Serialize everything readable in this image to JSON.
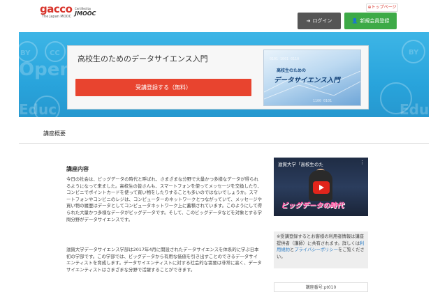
{
  "header": {
    "logo_text": "gacco",
    "logo_sub": "The Japan MOOC",
    "coop_small": "Certified by",
    "coop_big": "JMOOC",
    "toppage_label": "トップページ",
    "login_label": "ログイン",
    "register_label": "新規会員登録"
  },
  "hero": {
    "course_title": "高校生のためのデータサイエンス入門",
    "enroll_label": "受講登録する（無料）",
    "thumb_small": "高校生のための",
    "thumb_big": "データサイエンス入門"
  },
  "section": {
    "title": "講座概要"
  },
  "content": {
    "heading": "講座内容",
    "para1": "今日の社会は、ビッグデータの時代と呼ばれ、さまざまな分野で大量かつ多様なデータが得られるようになって来ました。高校生の皆さんも、スマートフォンを使ってメッセージを交換したり、コンビニでポイントカードを使って買い物をしたりすることも多いのではないでしょうか。スマートフォンやコンビニのレジは、コンピューターのネットワークとつながっていて、メッセージや買い物の履歴はデータとしてコンピュータネットワーク上に蓄積されています。このようにして得られた大量かつ多様なデータがビッグデータです。そして、このビッグデータなどを対象とする学問分野がデータサイエンスです。",
    "para2": "滋賀大学データサイエンス学部は2017年4月に開設されたデータサイエンスを体系的に学ぶ日本初の学部です。この学部では、ビッグデータから有用な価値を引き出すことのできるデータサイエンティストを育成します。データサイエンティストに対する社会的な需要は非常に高く、データサイエンティストはさまざまな分野で活躍することができます。"
  },
  "video": {
    "title": "滋賀大学「高校生のた",
    "caption": "ビッグデータの時代"
  },
  "notice": {
    "text_before": "※受講登録するとお客様の利用者情報は講座提供者（講師）に共有されます。詳しくは",
    "terms_link": "利用規約",
    "conj": "と",
    "privacy_link": "プライバシーポリシー",
    "text_after": "をご覧ください。"
  },
  "course_number": "講座番号:pt010"
}
